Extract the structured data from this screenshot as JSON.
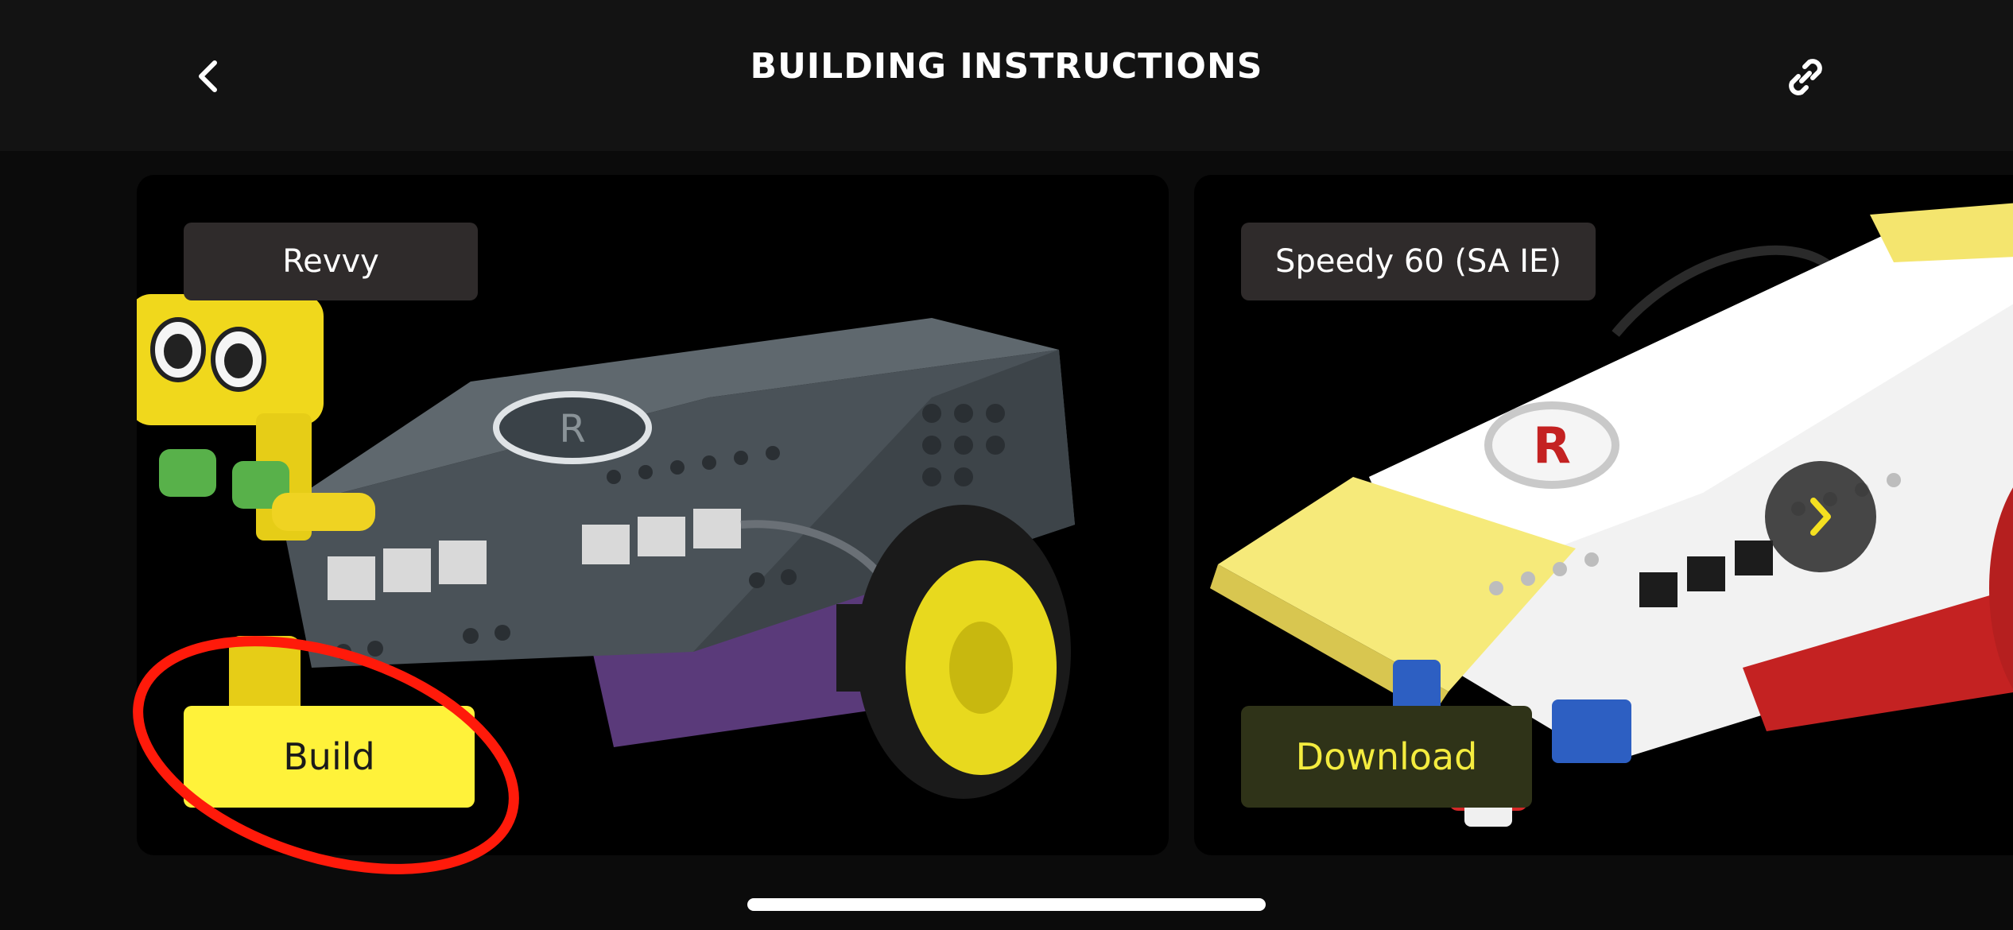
{
  "header": {
    "title": "BUILDING INSTRUCTIONS",
    "back_icon": "chevron-left-icon",
    "link_icon": "link-icon"
  },
  "cards": [
    {
      "label": "Revvy",
      "action_label": "Build"
    },
    {
      "label": "Speedy 60 (SA IE)",
      "action_label": "Download"
    }
  ],
  "next_icon": "chevron-right-icon",
  "colors": {
    "accent_yellow": "#fff23a",
    "download_bg": "#2f3318",
    "download_text": "#f4ec3f",
    "highlight_red": "#ff1a0a"
  }
}
